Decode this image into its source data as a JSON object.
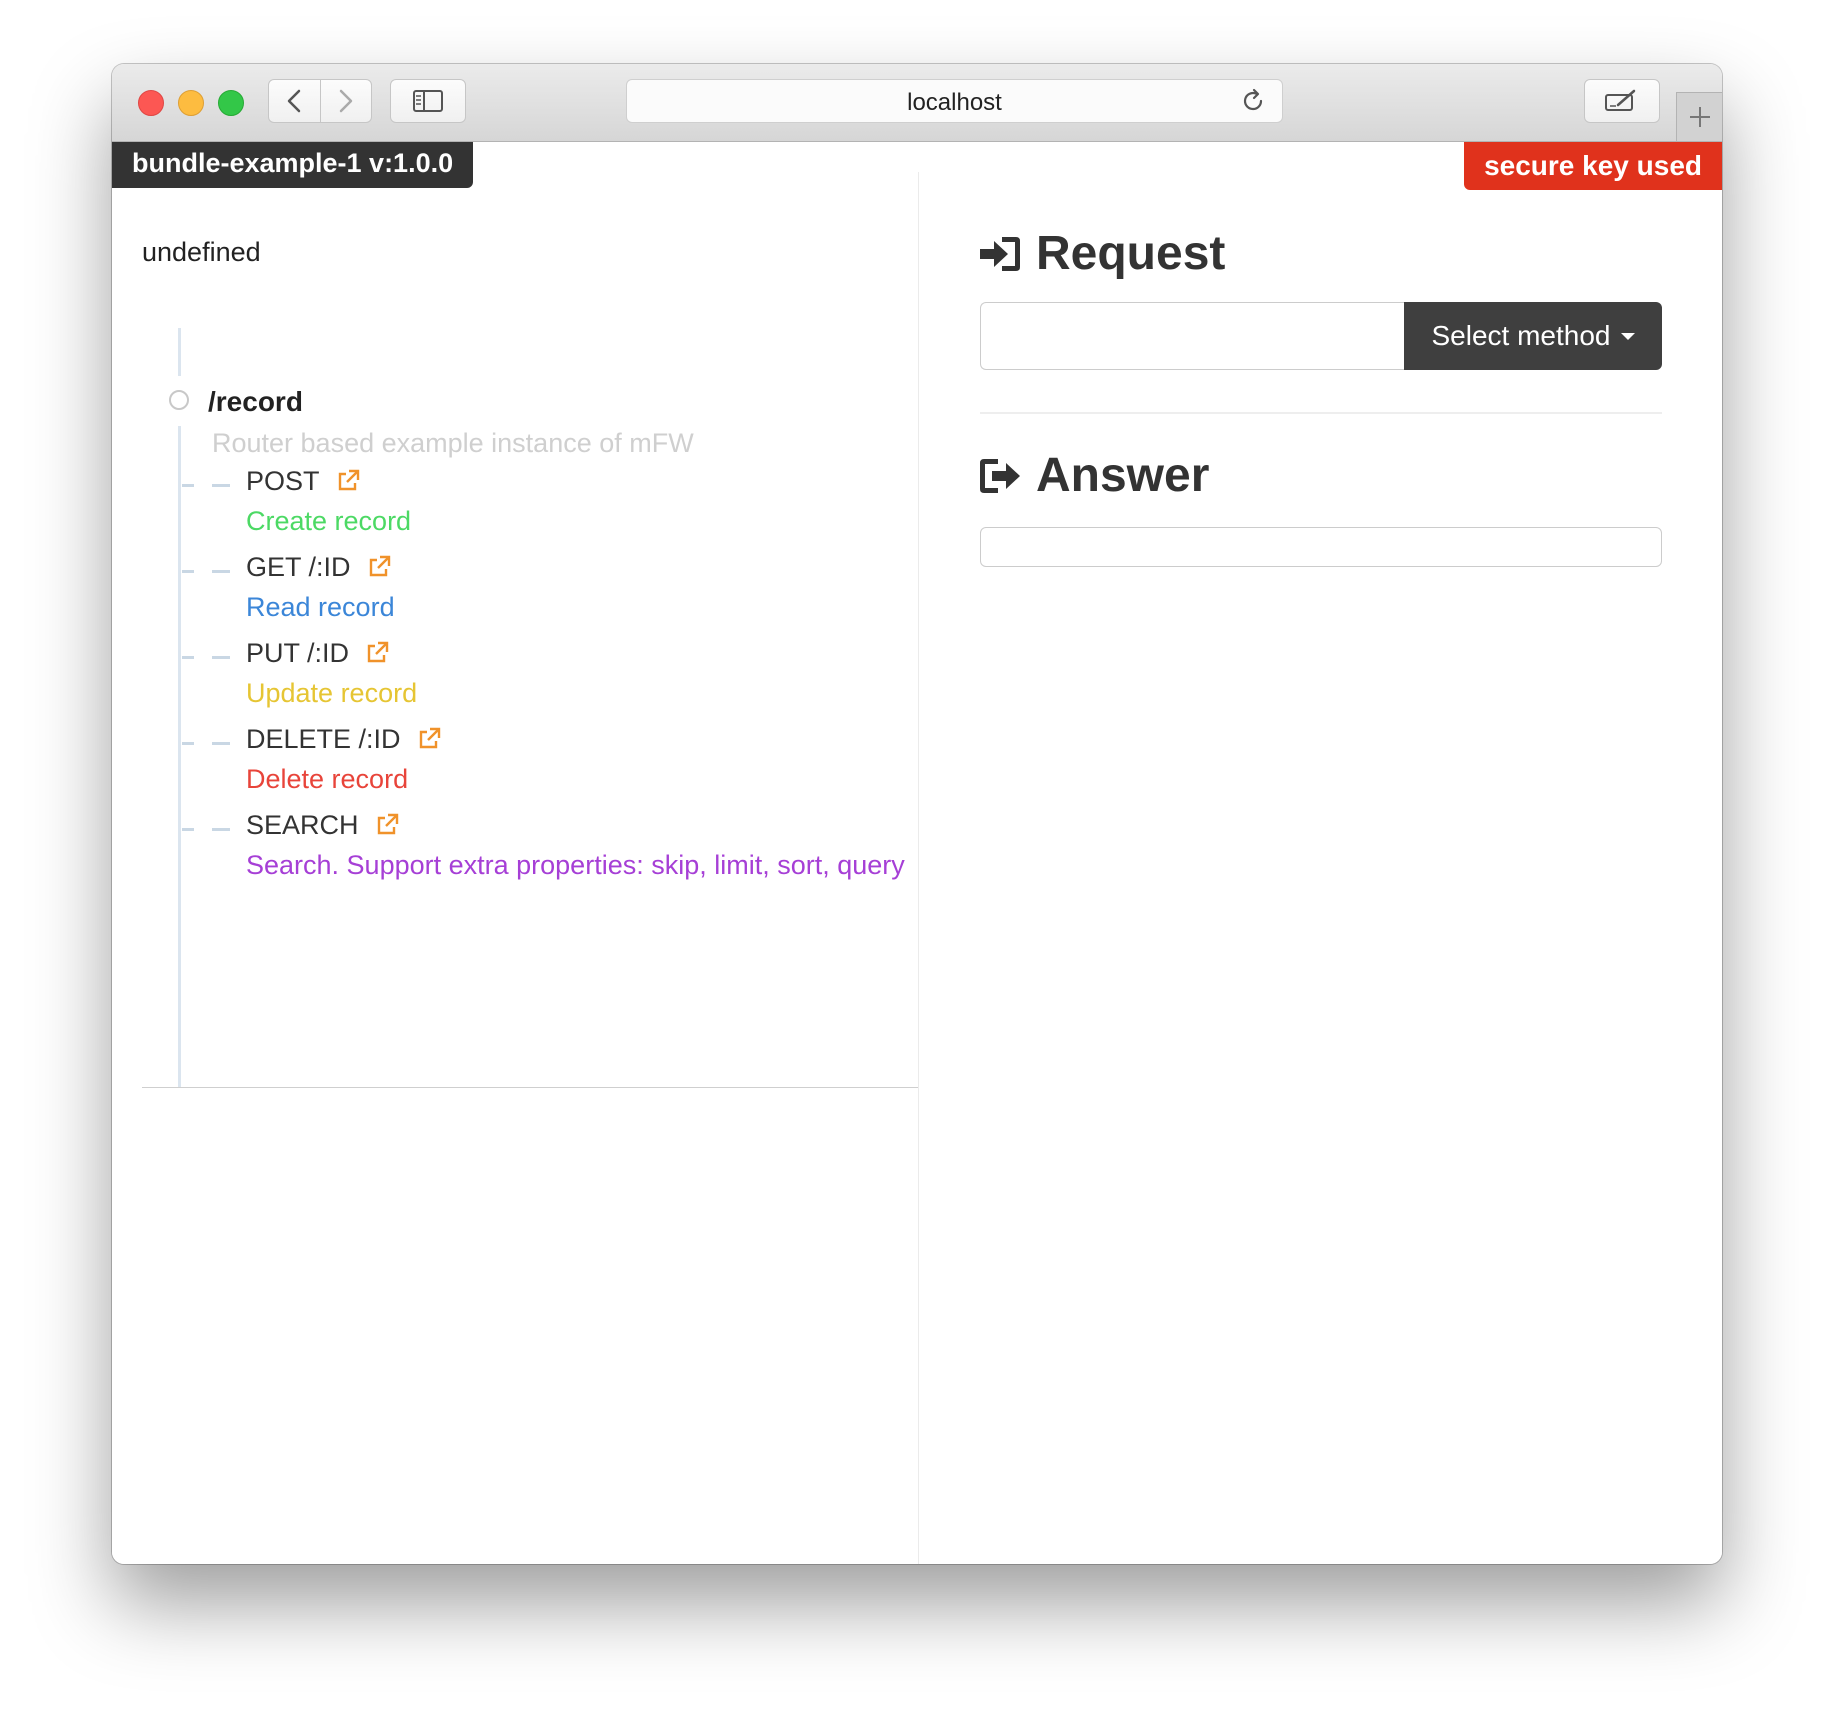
{
  "browser": {
    "url": "localhost"
  },
  "app": {
    "badge": "bundle-example-1 v:1.0.0",
    "secure_badge": "secure key used"
  },
  "left": {
    "description": "undefined",
    "route": {
      "path": "/record",
      "description": "Router based example instance of mFW"
    },
    "endpoints": [
      {
        "method": "POST",
        "description": "Create record",
        "color": "#4cd964"
      },
      {
        "method": "GET /:ID",
        "description": "Read record",
        "color": "#3b86d8"
      },
      {
        "method": "PUT /:ID",
        "description": "Update record",
        "color": "#e6c533"
      },
      {
        "method": "DELETE /:ID",
        "description": "Delete record",
        "color": "#e8443a"
      },
      {
        "method": "SEARCH",
        "description": "Search. Support extra properties: skip, limit, sort, query",
        "color": "#a63fd6"
      }
    ],
    "link_icon_color": "#f0922a"
  },
  "right": {
    "request_heading": "Request",
    "method_button": "Select method",
    "answer_heading": "Answer"
  },
  "colors": {
    "badge_bg": "#333333",
    "secure_bg": "#e0321c",
    "method_btn_bg": "#3f3f3f"
  }
}
